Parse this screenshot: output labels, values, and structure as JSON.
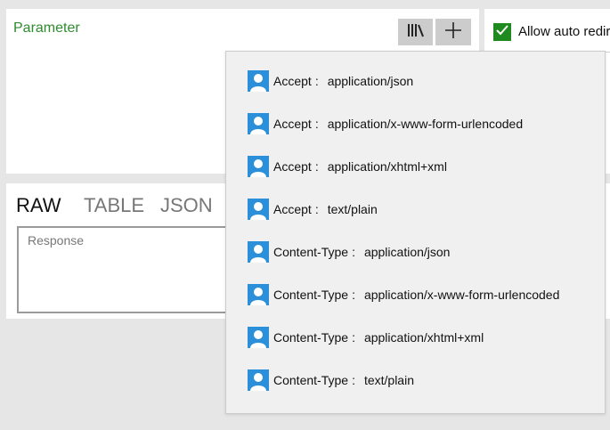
{
  "parameter_panel": {
    "title": "Parameter",
    "library_icon": "library-books-icon",
    "add_icon": "plus-icon"
  },
  "options_panel": {
    "allow_auto_redirect_label": "Allow auto redir",
    "allow_auto_redirect_checked": true
  },
  "response_panel": {
    "tabs": [
      "RAW",
      "TABLE",
      "JSON"
    ],
    "active_tab": "RAW",
    "placeholder": "Response"
  },
  "dropdown": {
    "item_icon": "user-icon",
    "items": [
      {
        "key": "Accept",
        "value": "application/json"
      },
      {
        "key": "Accept",
        "value": "application/x-www-form-urlencoded"
      },
      {
        "key": "Accept",
        "value": "application/xhtml+xml"
      },
      {
        "key": "Accept",
        "value": "text/plain"
      },
      {
        "key": "Content-Type",
        "value": "application/json"
      },
      {
        "key": "Content-Type",
        "value": "application/x-www-form-urlencoded"
      },
      {
        "key": "Content-Type",
        "value": "application/xhtml+xml"
      },
      {
        "key": "Content-Type",
        "value": "text/plain"
      }
    ],
    "separator": ":"
  },
  "colors": {
    "background": "#e6e6e6",
    "title_green": "#2e8b2e",
    "checkbox_green": "#1f8a1f",
    "icon_blue": "#2b8fd9",
    "dropdown_bg": "#f0f0f0"
  }
}
